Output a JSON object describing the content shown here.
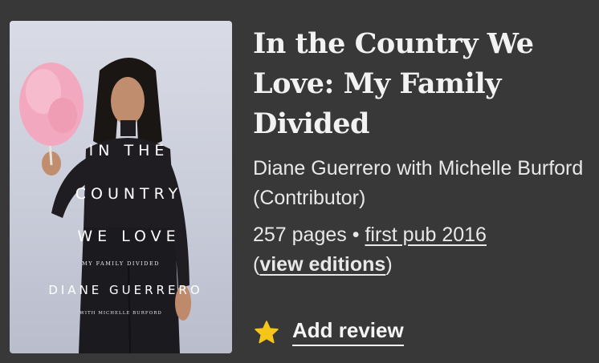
{
  "book": {
    "cover": {
      "title_line1": "IN THE",
      "title_line2": "COUNTRY",
      "title_line3": "WE LOVE",
      "subtitle": "MY FAMILY DIVIDED",
      "author": "DIANE GUERRERO",
      "with_line": "WITH MICHELLE BURFORD"
    },
    "title": "In the Country We Love: My Family Divided",
    "authors": "Diane Guerrero with Michelle Burford (Contributor)",
    "pages": "257 pages",
    "separator": "•",
    "first_pub": "first pub 2016",
    "editions_open": "(",
    "editions_link": "view editions",
    "editions_close": ")"
  },
  "actions": {
    "add_review_label": "Add review",
    "star_icon": "star-icon"
  },
  "colors": {
    "background": "#383838",
    "text": "#f2f2f2",
    "star": "#f5c518"
  }
}
